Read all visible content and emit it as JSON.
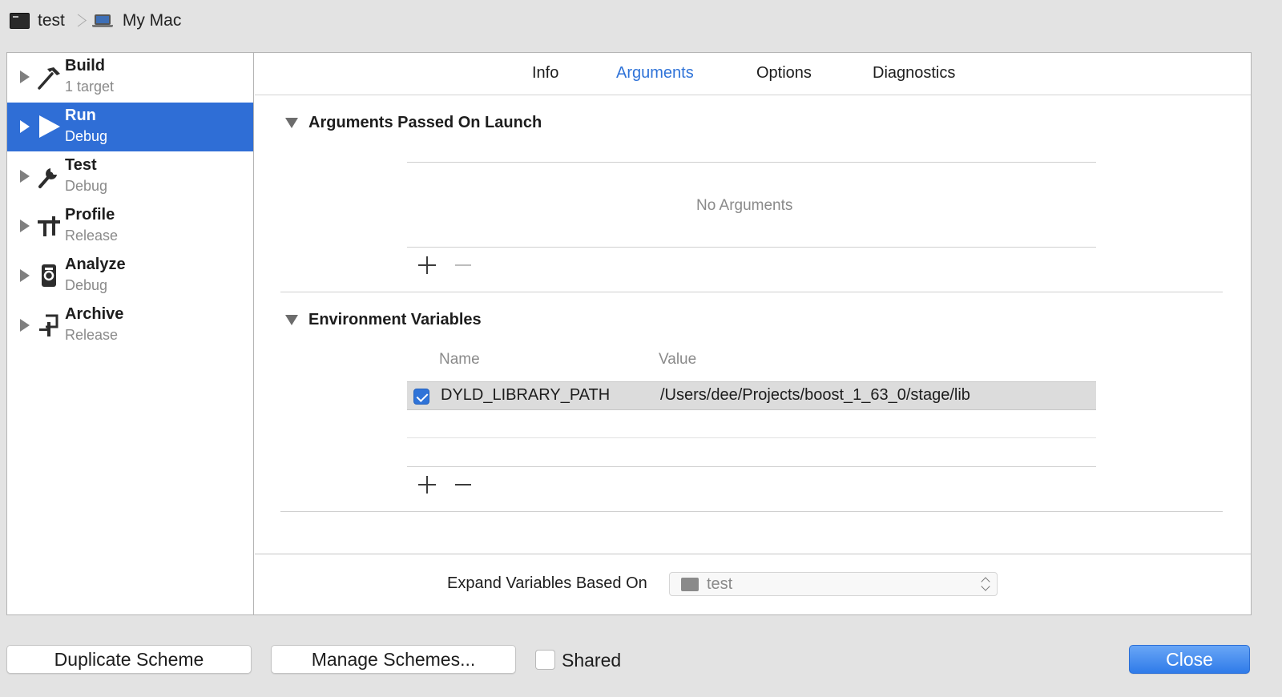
{
  "breadcrumb": {
    "scheme": "test",
    "destination": "My Mac"
  },
  "sidebar": {
    "items": [
      {
        "name": "Build",
        "sub": "1 target",
        "icon": "hammer-icon",
        "selected": false
      },
      {
        "name": "Run",
        "sub": "Debug",
        "icon": "play-icon",
        "selected": true
      },
      {
        "name": "Test",
        "sub": "Debug",
        "icon": "wrench-icon",
        "selected": false
      },
      {
        "name": "Profile",
        "sub": "Release",
        "icon": "caliper-icon",
        "selected": false
      },
      {
        "name": "Analyze",
        "sub": "Debug",
        "icon": "analyze-icon",
        "selected": false
      },
      {
        "name": "Archive",
        "sub": "Release",
        "icon": "archive-icon",
        "selected": false
      }
    ]
  },
  "tabs": [
    {
      "label": "Info",
      "active": false
    },
    {
      "label": "Arguments",
      "active": true
    },
    {
      "label": "Options",
      "active": false
    },
    {
      "label": "Diagnostics",
      "active": false
    }
  ],
  "arguments_section": {
    "title": "Arguments Passed On Launch",
    "empty_text": "No Arguments"
  },
  "env_section": {
    "title": "Environment Variables",
    "columns": {
      "name": "Name",
      "value": "Value"
    },
    "rows": [
      {
        "enabled": true,
        "name": "DYLD_LIBRARY_PATH",
        "value": "/Users/dee/Projects/boost_1_63_0/stage/lib"
      }
    ]
  },
  "expand": {
    "label": "Expand Variables Based On",
    "selected": "test"
  },
  "footer": {
    "duplicate_label": "Duplicate Scheme",
    "manage_label": "Manage Schemes...",
    "shared_label": "Shared",
    "shared_checked": false,
    "close_label": "Close"
  },
  "colors": {
    "accent": "#2f73d8",
    "selection": "#2f6ed6"
  }
}
